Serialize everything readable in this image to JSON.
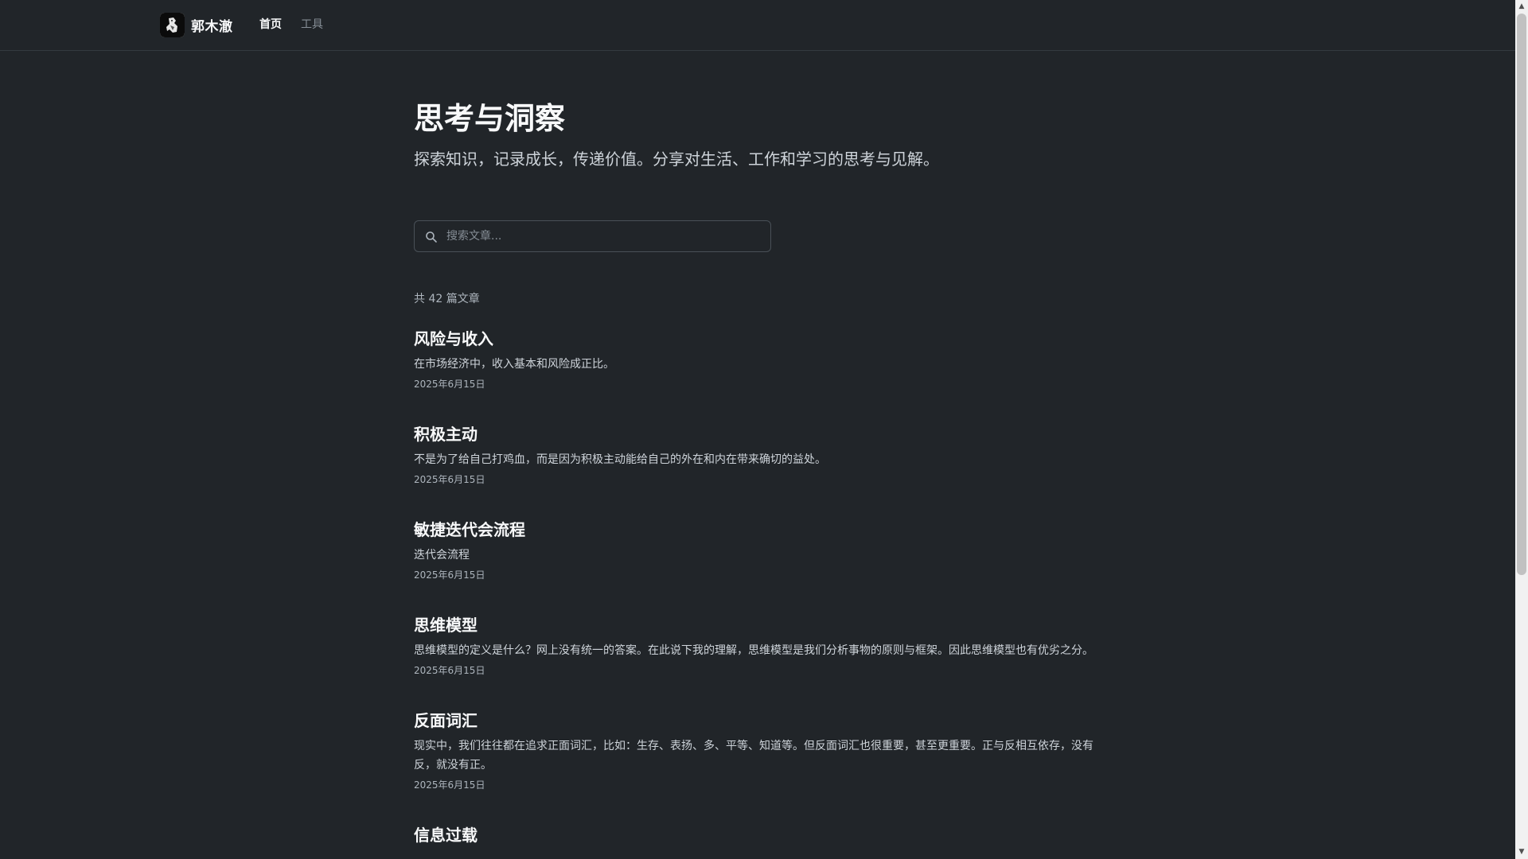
{
  "site": {
    "name": "郭木澈",
    "nav": [
      {
        "label": "首页",
        "active": true
      },
      {
        "label": "工具",
        "active": false
      }
    ]
  },
  "hero": {
    "title": "思考与洞察",
    "subtitle": "探索知识，记录成长，传递价值。分享对生活、工作和学习的思考与见解。"
  },
  "search": {
    "placeholder": "搜索文章...",
    "value": ""
  },
  "count_text": "共 42 篇文章",
  "posts": [
    {
      "title": "风险与收入",
      "excerpt": "在市场经济中，收入基本和风险成正比。",
      "date": "2025年6月15日"
    },
    {
      "title": "积极主动",
      "excerpt": "不是为了给自己打鸡血，而是因为积极主动能给自己的外在和内在带来确切的益处。",
      "date": "2025年6月15日"
    },
    {
      "title": "敏捷迭代会流程",
      "excerpt": "迭代会流程",
      "date": "2025年6月15日"
    },
    {
      "title": "思维模型",
      "excerpt": "思维模型的定义是什么？网上没有统一的答案。在此说下我的理解，思维模型是我们分析事物的原则与框架。因此思维模型也有优劣之分。",
      "date": "2025年6月15日"
    },
    {
      "title": "反面词汇",
      "excerpt": "现实中，我们往往都在追求正面词汇，比如：生存、表扬、多、平等、知道等。但反面词汇也很重要，甚至更重要。正与反相互依存，没有反，就没有正。",
      "date": "2025年6月15日"
    },
    {
      "title": "信息过载",
      "excerpt": "",
      "date": ""
    }
  ],
  "colors": {
    "background": "#212529",
    "text": "#f8f9fa",
    "muted": "#adb5bd"
  }
}
